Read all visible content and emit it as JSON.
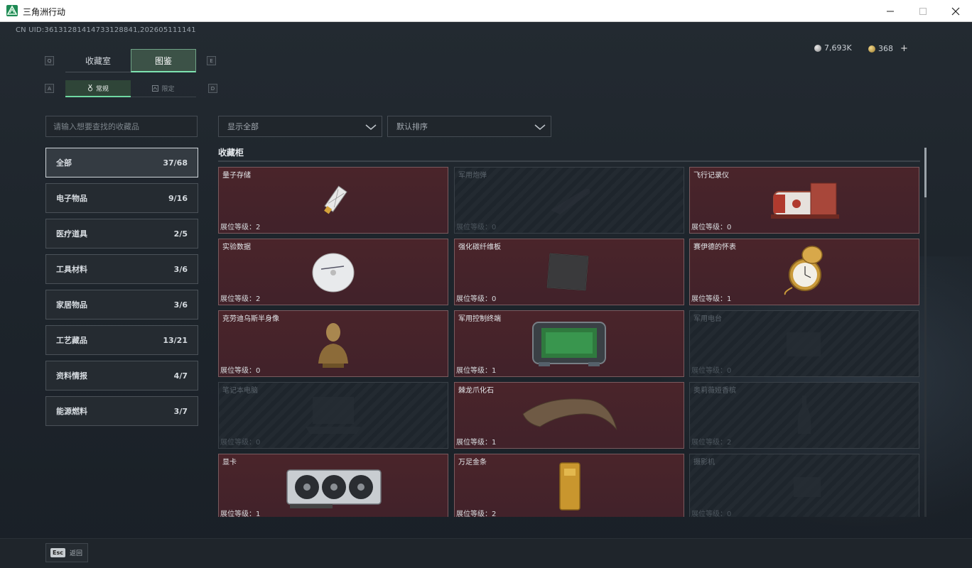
{
  "window": {
    "title": "三角洲行动"
  },
  "header": {
    "uid": "CN UID:36131281414733128841,202605111141",
    "currency_silver": "7,693K",
    "currency_gold": "368",
    "add_symbol": "+"
  },
  "tabs": {
    "key_left": "Q",
    "key_right": "E",
    "items": [
      {
        "label": "收藏室"
      },
      {
        "label": "图鉴"
      }
    ]
  },
  "subtabs": {
    "key_left": "A",
    "key_right": "D",
    "items": [
      {
        "label": "常规"
      },
      {
        "label": "限定"
      }
    ]
  },
  "search": {
    "placeholder": "请输入想要查找的收藏品"
  },
  "categories": [
    {
      "label": "全部",
      "count": "37/68"
    },
    {
      "label": "电子物品",
      "count": "9/16"
    },
    {
      "label": "医疗道具",
      "count": "2/5"
    },
    {
      "label": "工具材料",
      "count": "3/6"
    },
    {
      "label": "家居物品",
      "count": "3/6"
    },
    {
      "label": "工艺藏品",
      "count": "13/21"
    },
    {
      "label": "资料情报",
      "count": "4/7"
    },
    {
      "label": "能源燃料",
      "count": "3/7"
    }
  ],
  "filters": {
    "show": "显示全部",
    "sort": "默认排序"
  },
  "section": {
    "title": "收藏柜"
  },
  "items": [
    {
      "name": "量子存储",
      "level": "展位等级：2",
      "unlocked": true,
      "icon": "usb-drive-icon"
    },
    {
      "name": "军用炮弹",
      "level": "展位等级：0",
      "unlocked": false,
      "icon": "shell-icon"
    },
    {
      "name": "飞行记录仪",
      "level": "展位等级：0",
      "unlocked": true,
      "icon": "flight-recorder-icon"
    },
    {
      "name": "实验数据",
      "level": "展位等级：2",
      "unlocked": true,
      "icon": "disc-icon"
    },
    {
      "name": "强化碳纤维板",
      "level": "展位等级：0",
      "unlocked": true,
      "icon": "carbon-plate-icon"
    },
    {
      "name": "赛伊德的怀表",
      "level": "展位等级：1",
      "unlocked": true,
      "icon": "pocket-watch-icon"
    },
    {
      "name": "克劳迪乌斯半身像",
      "level": "展位等级：0",
      "unlocked": true,
      "icon": "bust-icon"
    },
    {
      "name": "军用控制终端",
      "level": "展位等级：1",
      "unlocked": true,
      "icon": "control-terminal-icon"
    },
    {
      "name": "军用电台",
      "level": "展位等级：0",
      "unlocked": false,
      "icon": "radio-icon"
    },
    {
      "name": "笔记本电脑",
      "level": "展位等级：0",
      "unlocked": false,
      "icon": "laptop-icon"
    },
    {
      "name": "棘龙爪化石",
      "level": "展位等级：1",
      "unlocked": true,
      "icon": "claw-fossil-icon"
    },
    {
      "name": "奥莉薇娅香槟",
      "level": "展位等级：2",
      "unlocked": false,
      "icon": "champagne-icon"
    },
    {
      "name": "显卡",
      "level": "展位等级：1",
      "unlocked": true,
      "icon": "gpu-icon"
    },
    {
      "name": "万足金条",
      "level": "展位等级：2",
      "unlocked": true,
      "icon": "gold-bar-icon"
    },
    {
      "name": "摄影机",
      "level": "展位等级：0",
      "unlocked": false,
      "icon": "camera-icon"
    }
  ],
  "footer": {
    "esc_key": "Esc",
    "back_label": "返回"
  }
}
